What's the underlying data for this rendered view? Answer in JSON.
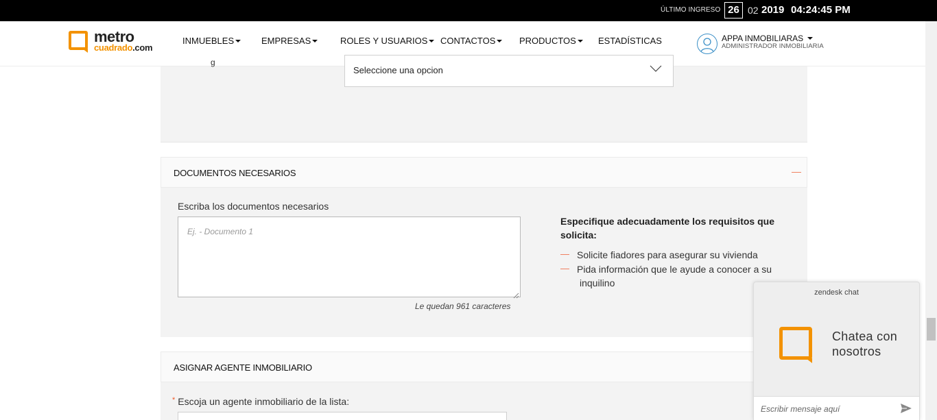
{
  "topbar": {
    "last_login_label": "ÚLTIMO INGRESO",
    "day": "26",
    "month": "02",
    "year": "2019",
    "time": "04:24:45 PM"
  },
  "logo": {
    "line1": "metro",
    "line2_brand": "cuadrado",
    "line2_suffix": ".com"
  },
  "nav": {
    "items": [
      {
        "label": "INMUEBLES",
        "dropdown": true
      },
      {
        "label": "EMPRESAS",
        "dropdown": true
      },
      {
        "label": "ROLES Y USUARIOS",
        "dropdown": true
      },
      {
        "label": "CONTACTOS",
        "dropdown": true
      },
      {
        "label": "PRODUCTOS",
        "dropdown": true
      },
      {
        "label": "ESTADÍSTICAS",
        "dropdown": false
      }
    ],
    "user": {
      "name": "APPA INMOBILIARAS",
      "role": "ADMINISTRADOR INMOBILIARIA"
    }
  },
  "top_panel": {
    "select_value": "Seleccione una opcion",
    "cut_label": "g"
  },
  "documentos": {
    "header": "DOCUMENTOS NECESARIOS",
    "field_label": "Escriba los documentos necesarios",
    "placeholder": "Ej. - Documento 1",
    "remaining": "Le quedan 961 caracteres",
    "requirements_title": "Especifique adecuadamente los requisitos que solicita:",
    "requirements": [
      "Solicite fiadores para asegurar su vivienda",
      "Pida información que le ayude a conocer a su",
      "inquilino"
    ]
  },
  "agente": {
    "header": "ASIGNAR AGENTE INMOBILIARIO",
    "required_mark": "*",
    "field_label": "Escoja un agente inmobiliario de la lista:"
  },
  "chat": {
    "brand": "zendesk chat",
    "cta_line1": "Chatea con",
    "cta_line2": "nosotros",
    "input_placeholder": "Escribir mensaje aquí"
  },
  "colors": {
    "accent_orange": "#f39200",
    "dash_orange": "#f08060",
    "avatar_blue": "#3a8fc7"
  }
}
